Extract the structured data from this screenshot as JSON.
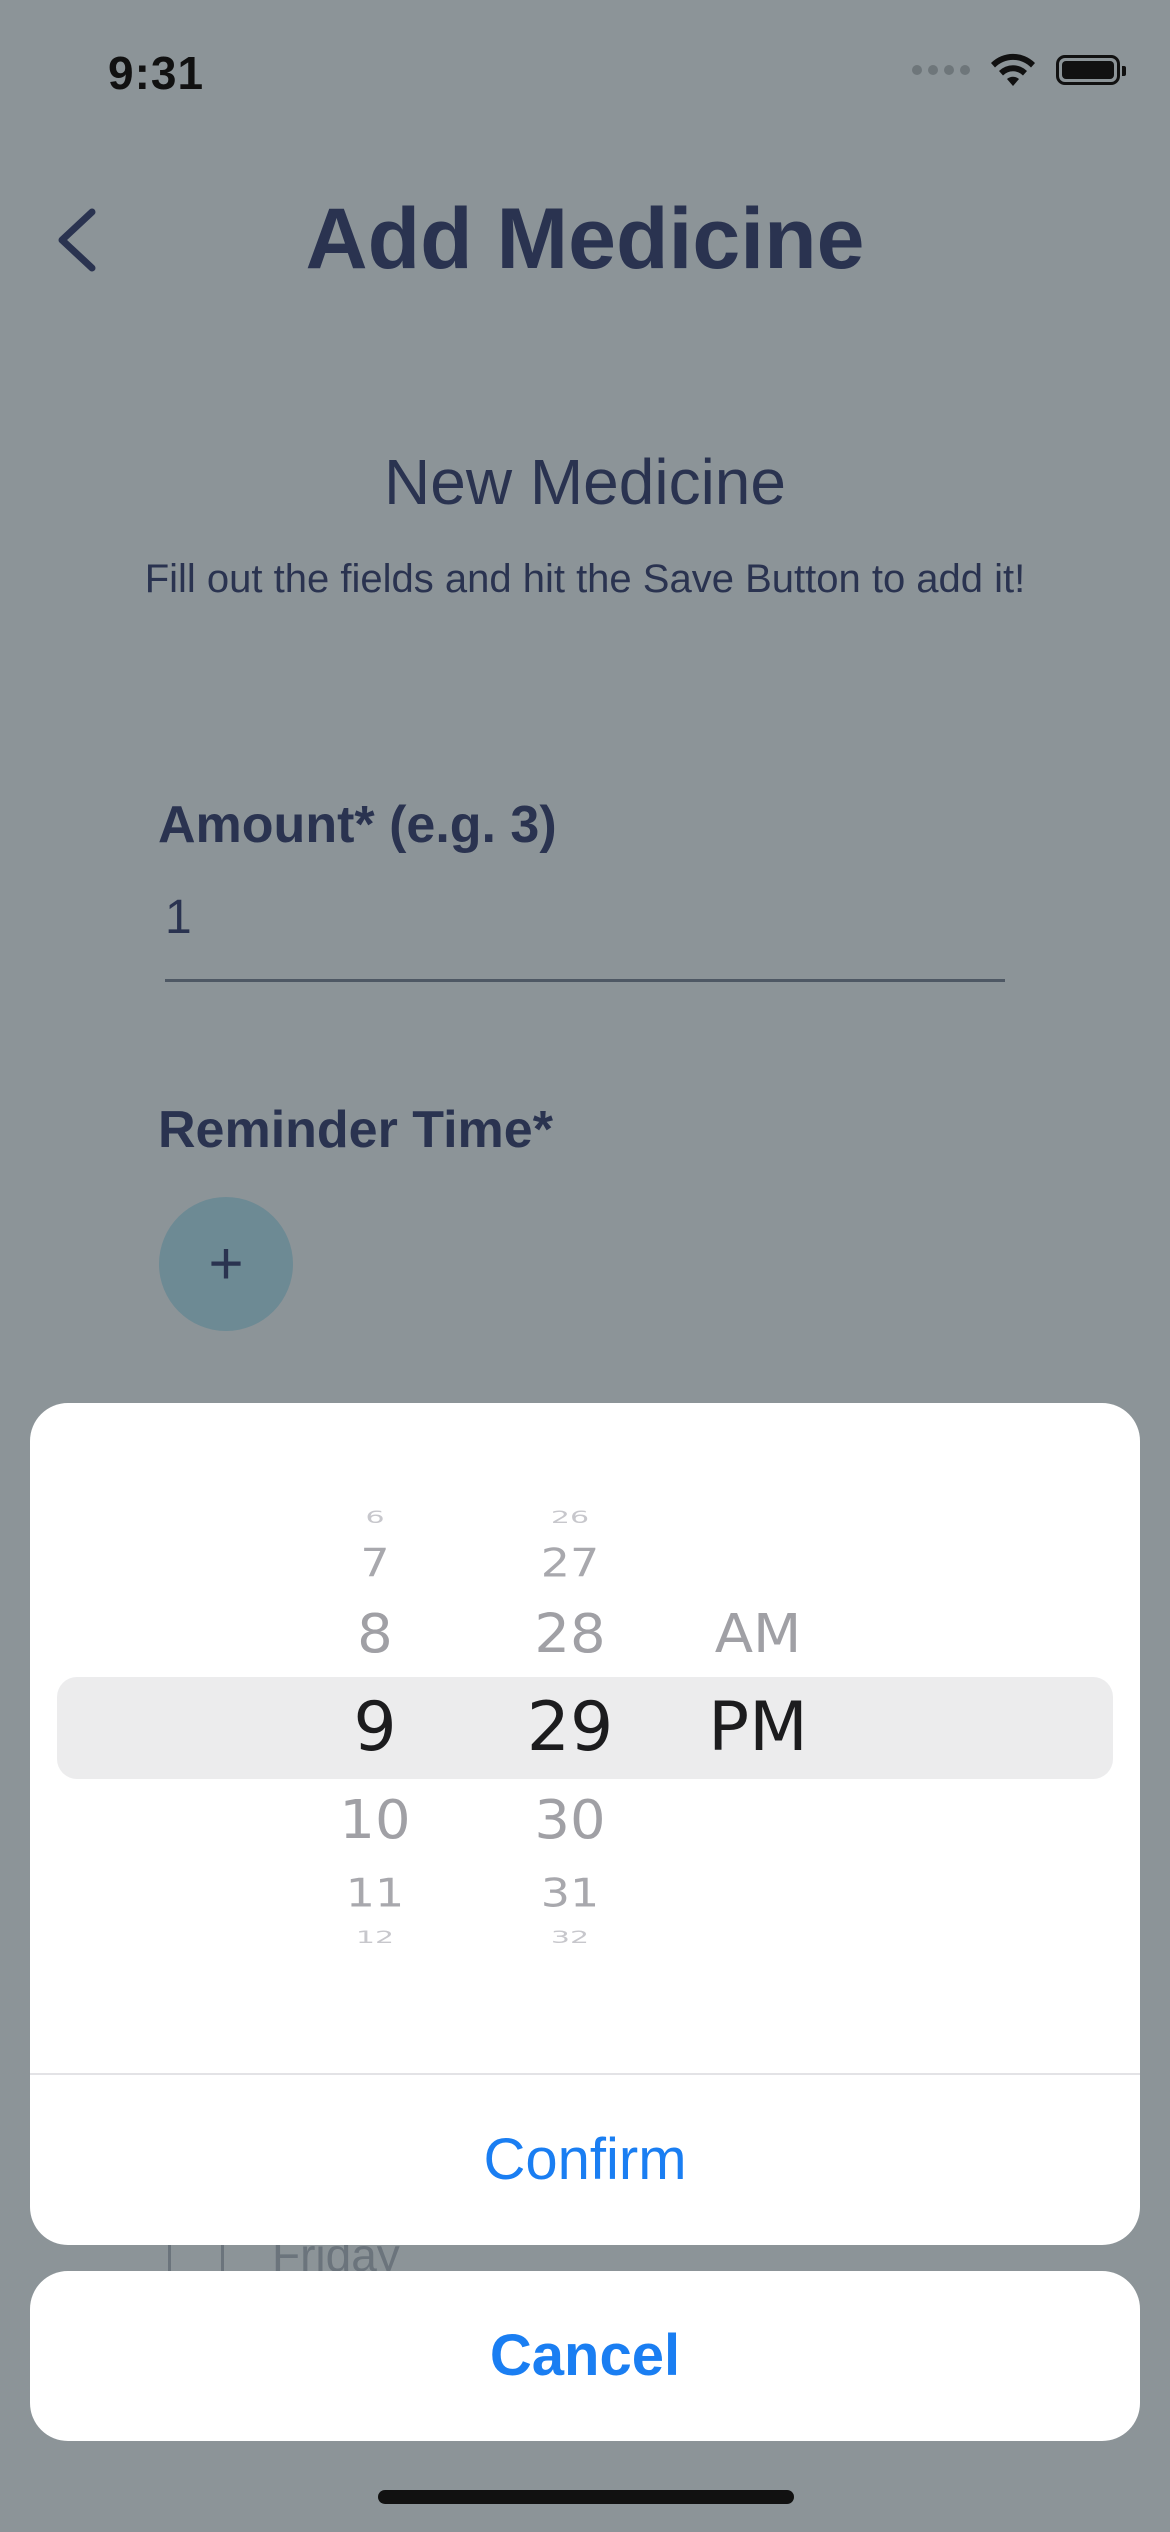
{
  "status_bar": {
    "time": "9:31"
  },
  "nav": {
    "title": "Add Medicine"
  },
  "form": {
    "section_title": "New Medicine",
    "section_subtitle": "Fill out the fields and hit the Save Button to add it!",
    "amount_label": "Amount* (e.g. 3)",
    "amount_value": "1",
    "reminder_label": "Reminder Time*",
    "add_time_symbol": "+",
    "partial_day_label": "Friday"
  },
  "picker": {
    "hours": [
      "6",
      "7",
      "8",
      "9",
      "10",
      "11",
      "12"
    ],
    "minutes": [
      "26",
      "27",
      "28",
      "29",
      "30",
      "31",
      "32"
    ],
    "periods": [
      "AM",
      "PM"
    ],
    "selected_hour": "9",
    "selected_minute": "29",
    "selected_period": "PM"
  },
  "actions": {
    "confirm_label": "Confirm",
    "cancel_label": "Cancel"
  },
  "colors": {
    "accent": "#1a7ef2",
    "text_dark": "#2a3350",
    "overlay_bg": "#8c9498"
  }
}
